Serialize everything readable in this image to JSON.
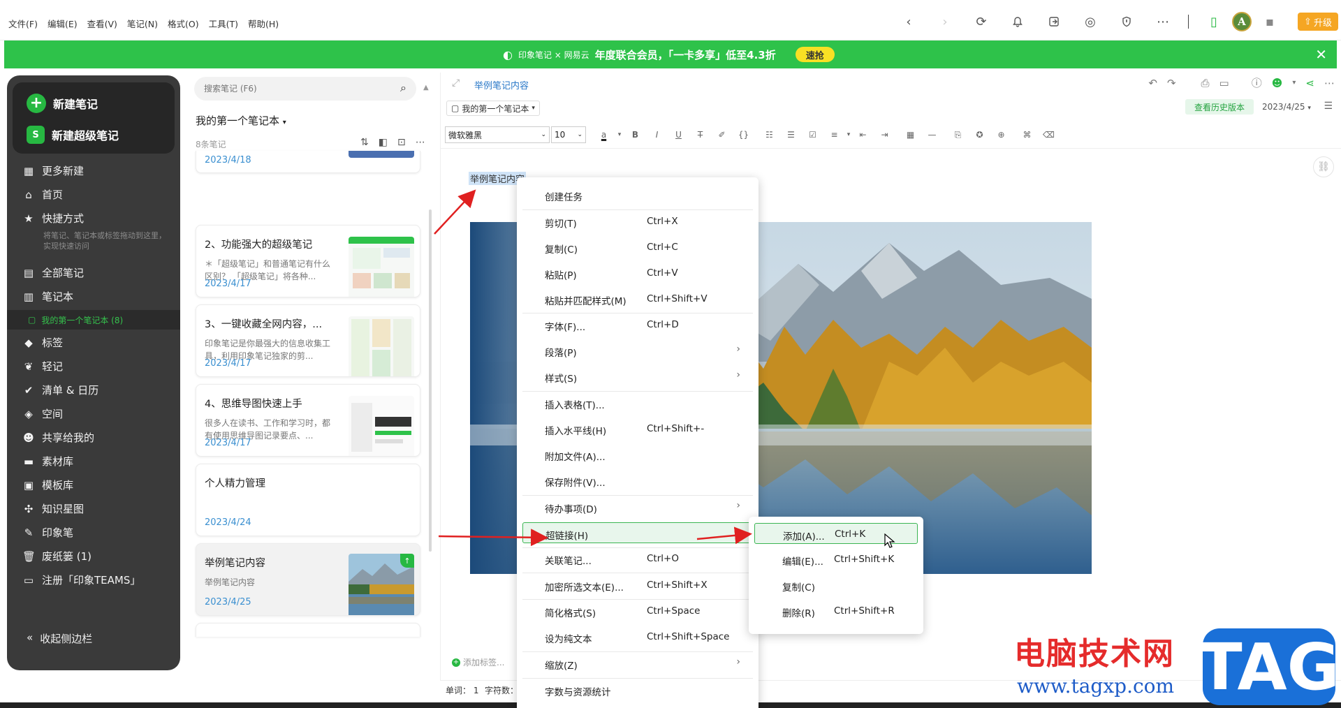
{
  "menubar": {
    "menus": [
      "文件(F)",
      "编辑(E)",
      "查看(V)",
      "笔记(N)",
      "格式(O)",
      "工具(T)",
      "帮助(H)"
    ],
    "avatar_letter": "A",
    "upgrade_label": "升级"
  },
  "promo": {
    "brand": "印象笔记 × 网易云",
    "text": "年度联合会员，「一卡多享」低至4.3折",
    "cta": "速抢"
  },
  "sidebar": {
    "new_note": "新建笔记",
    "new_super_note": "新建超级笔记",
    "items": [
      {
        "label": "更多新建",
        "icon": "grid-icon"
      },
      {
        "label": "首页",
        "icon": "home-icon"
      },
      {
        "label": "快捷方式",
        "icon": "star-icon"
      },
      {
        "label": "全部笔记",
        "icon": "notes-icon"
      },
      {
        "label": "笔记本",
        "icon": "notebook-icon"
      },
      {
        "label": "标签",
        "icon": "tag-icon"
      },
      {
        "label": "轻记",
        "icon": "leaf-icon"
      },
      {
        "label": "清单 & 日历",
        "icon": "check-icon"
      },
      {
        "label": "空间",
        "icon": "cube-icon"
      },
      {
        "label": "共享给我的",
        "icon": "share-user-icon"
      },
      {
        "label": "素材库",
        "icon": "library-icon"
      },
      {
        "label": "模板库",
        "icon": "template-icon"
      },
      {
        "label": "知识星图",
        "icon": "graph-icon"
      },
      {
        "label": "印象笔",
        "icon": "pen-icon"
      },
      {
        "label": "废纸篓 (1)",
        "icon": "trash-icon"
      },
      {
        "label": "注册「印象TEAMS」",
        "icon": "teams-icon"
      }
    ],
    "shortcut_hint": "将笔记、笔记本或标签拖动到这里，实现快速访问",
    "sub_notebook": "我的第一个笔记本 (8)",
    "collapse": "收起侧边栏"
  },
  "notelist": {
    "search_placeholder": "搜索笔记 (F6)",
    "notebook_title": "我的第一个笔记本",
    "count": "8条笔记",
    "cards": [
      {
        "title": "",
        "snippet": "",
        "date": "2023/4/18"
      },
      {
        "title": "2、功能强大的超级笔记",
        "snippet": "＊「超级笔记」和普通笔记有什么区别？ 「超级笔记」将各种...",
        "date": "2023/4/17"
      },
      {
        "title": "3、一键收藏全网内容，...",
        "snippet": "印象笔记是你最强大的信息收集工具，利用印象笔记独家的剪...",
        "date": "2023/4/17"
      },
      {
        "title": "4、思维导图快速上手",
        "snippet": "很多人在读书、工作和学习时，都有使用思维导图记录要点、...",
        "date": "2023/4/17"
      },
      {
        "title": "个人精力管理",
        "snippet": "",
        "date": "2023/4/24"
      },
      {
        "title": "举例笔记内容",
        "snippet": "举例笔记内容",
        "date": "2023/4/25"
      }
    ]
  },
  "editor": {
    "title_link": "举例笔记内容",
    "notebook_select": "我的第一个笔记本",
    "history_btn": "查看历史版本",
    "date": "2023/4/25",
    "font": "微软雅黑",
    "size": "10",
    "body_text": "举例笔记内容",
    "add_tag": "添加标签..."
  },
  "status": {
    "words": "单词：  1",
    "chars": "字符数："
  },
  "context_menu": {
    "items": [
      {
        "label": "创建任务",
        "shortcut": ""
      },
      {
        "label": "剪切(T)",
        "shortcut": "Ctrl+X"
      },
      {
        "label": "复制(C)",
        "shortcut": "Ctrl+C"
      },
      {
        "label": "粘贴(P)",
        "shortcut": "Ctrl+V"
      },
      {
        "label": "粘贴并匹配样式(M)",
        "shortcut": "Ctrl+Shift+V"
      },
      {
        "label": "字体(F)...",
        "shortcut": "Ctrl+D"
      },
      {
        "label": "段落(P)",
        "shortcut": ""
      },
      {
        "label": "样式(S)",
        "shortcut": ""
      },
      {
        "label": "插入表格(T)...",
        "shortcut": ""
      },
      {
        "label": "插入水平线(H)",
        "shortcut": "Ctrl+Shift+-"
      },
      {
        "label": "附加文件(A)...",
        "shortcut": ""
      },
      {
        "label": "保存附件(V)...",
        "shortcut": ""
      },
      {
        "label": "待办事项(D)",
        "shortcut": ""
      },
      {
        "label": "超链接(H)",
        "shortcut": ""
      },
      {
        "label": "关联笔记...",
        "shortcut": "Ctrl+O"
      },
      {
        "label": "加密所选文本(E)...",
        "shortcut": "Ctrl+Shift+X"
      },
      {
        "label": "简化格式(S)",
        "shortcut": "Ctrl+Space"
      },
      {
        "label": "设为纯文本",
        "shortcut": "Ctrl+Shift+Space"
      },
      {
        "label": "缩放(Z)",
        "shortcut": ""
      },
      {
        "label": "字数与资源统计",
        "shortcut": ""
      }
    ]
  },
  "submenu": {
    "items": [
      {
        "label": "添加(A)...",
        "shortcut": "Ctrl+K"
      },
      {
        "label": "编辑(E)...",
        "shortcut": "Ctrl+Shift+K"
      },
      {
        "label": "复制(C)",
        "shortcut": ""
      },
      {
        "label": "删除(R)",
        "shortcut": "Ctrl+Shift+R"
      }
    ]
  },
  "watermark": {
    "cn": "电脑技术网",
    "url": "www.tagxp.com",
    "tag": "TAG"
  },
  "colors": {
    "brand_green": "#2ec24a",
    "sidebar_bg": "#3a3a3a",
    "link_blue": "#2b79c8",
    "highlight_border": "#3ab552",
    "annotation_red": "#e02020"
  }
}
